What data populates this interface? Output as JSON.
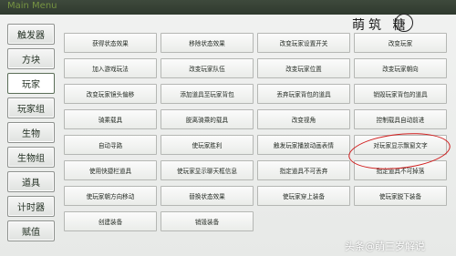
{
  "topbar": {
    "title": "Main Menu"
  },
  "brand": {
    "text": "萌筑 糖"
  },
  "sidebar": {
    "items": [
      {
        "label": "触发器"
      },
      {
        "label": "方块"
      },
      {
        "label": "玩家"
      },
      {
        "label": "玩家组"
      },
      {
        "label": "生物"
      },
      {
        "label": "生物组"
      },
      {
        "label": "道具"
      },
      {
        "label": "计时器"
      },
      {
        "label": "赋值"
      }
    ],
    "active_index": 2
  },
  "grid": {
    "rows": [
      [
        "获得状态效果",
        "移除状态效果",
        "改变玩家设置开关",
        "改变玩家"
      ],
      [
        "加入游戏玩法",
        "改变玩家队伍",
        "改变玩家位置",
        "改变玩家朝向"
      ],
      [
        "改变玩家镜头偏移",
        "添加道具至玩家背包",
        "丢弃玩家背包的道具",
        "销毁玩家背包的道具"
      ],
      [
        "骑乘载具",
        "脱离骑乘的载具",
        "改变视角",
        "控制载具自动前进"
      ],
      [
        "自动寻路",
        "使玩家胜利",
        "触发玩家播放动画表情",
        "对玩家显示飘窗文字"
      ],
      [
        "使用快捷栏道具",
        "使玩家显示聊天框信息",
        "指定道具不可丢弃",
        "指定道具不可掉落"
      ],
      [
        "使玩家朝方向移动",
        "替换状态效果",
        "使玩家穿上装备",
        "使玩家脱下装备"
      ],
      [
        "创建装备",
        "销毁装备"
      ]
    ]
  },
  "overlay": {
    "highlighted_cell": "对玩家显示飘窗文字"
  },
  "watermark": {
    "text": "头条@萌三岁解说"
  }
}
